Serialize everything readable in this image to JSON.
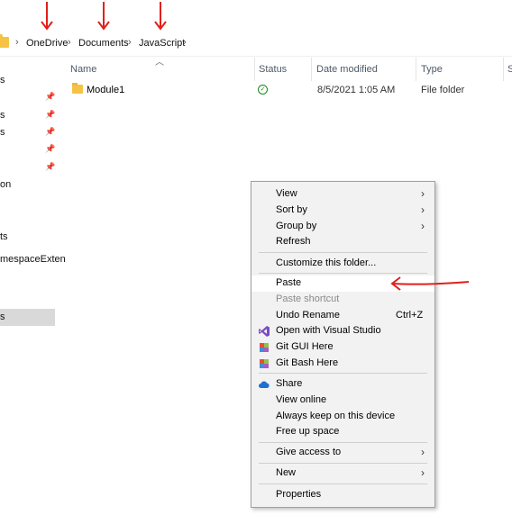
{
  "breadcrumb": [
    "OneDrive",
    "Documents",
    "JavaScript"
  ],
  "nav": {
    "items": [
      "s",
      "s",
      "s",
      "on",
      "ts",
      "mespaceExten",
      "s"
    ]
  },
  "columns": {
    "name": "Name",
    "status": "Status",
    "date_modified": "Date modified",
    "type": "Type",
    "size": "S"
  },
  "files": [
    {
      "name": "Module1",
      "date": "8/5/2021 1:05 AM",
      "type": "File folder"
    }
  ],
  "context_menu": {
    "view": "View",
    "sort_by": "Sort by",
    "group_by": "Group by",
    "refresh": "Refresh",
    "customize": "Customize this folder...",
    "paste": "Paste",
    "paste_shortcut": "Paste shortcut",
    "undo_rename": "Undo Rename",
    "undo_shortcut": "Ctrl+Z",
    "open_vs": "Open with Visual Studio",
    "git_gui": "Git GUI Here",
    "git_bash": "Git Bash Here",
    "share": "Share",
    "view_online": "View online",
    "always_keep": "Always keep on this device",
    "free_up": "Free up space",
    "give_access": "Give access to",
    "new": "New",
    "properties": "Properties"
  },
  "colors": {
    "annotation": "#e0201a",
    "folder": "#f5c244",
    "menu_bg": "#f2f2f2"
  }
}
